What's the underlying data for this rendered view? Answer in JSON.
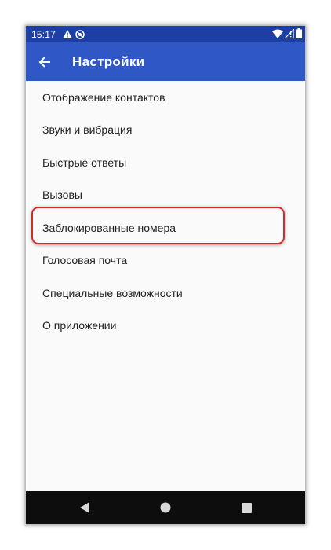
{
  "status_bar": {
    "time": "15:17",
    "left_icons": [
      "alert-icon",
      "sync-disabled-icon"
    ],
    "right_icons": [
      "wifi-icon",
      "cell-signal-icon",
      "battery-icon"
    ]
  },
  "app_bar": {
    "back_icon": "arrow-back-icon",
    "title": "Настройки"
  },
  "settings": {
    "items": [
      {
        "label": "Отображение контактов"
      },
      {
        "label": "Звуки и вибрация"
      },
      {
        "label": "Быстрые ответы"
      },
      {
        "label": "Вызовы"
      },
      {
        "label": "Заблокированные номера",
        "highlighted": true
      },
      {
        "label": "Голосовая почта"
      },
      {
        "label": "Специальные возможности"
      },
      {
        "label": "О приложении"
      }
    ]
  },
  "nav_bar": {
    "buttons": [
      "back-triangle-icon",
      "home-circle-icon",
      "recents-square-icon"
    ]
  },
  "colors": {
    "status_bar": "#1d3ea3",
    "app_bar": "#3057c6",
    "highlight": "#d62a2a",
    "nav_bar": "#0d0d0d"
  }
}
